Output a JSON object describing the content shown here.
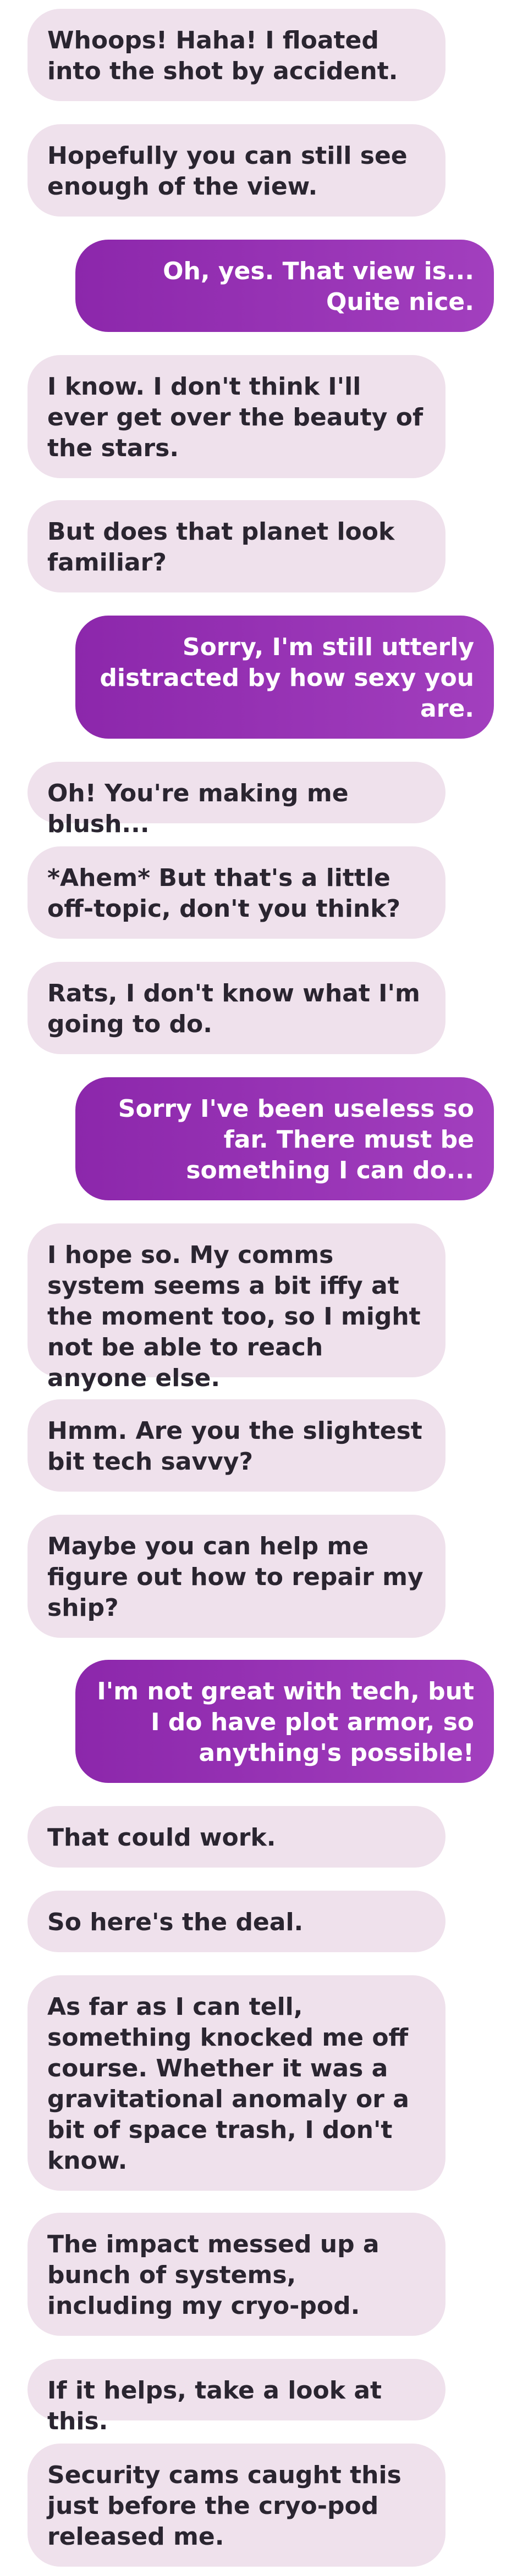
{
  "conversation": {
    "messages": [
      {
        "sender": "character",
        "text": "Whoops! Haha! I floated into the shot by accident."
      },
      {
        "sender": "character",
        "text": "Hopefully you can still see enough of the view."
      },
      {
        "sender": "user",
        "text": "Oh, yes. That view is... Quite nice."
      },
      {
        "sender": "character",
        "text": "I know. I don't think I'll ever get over the beauty of the stars."
      },
      {
        "sender": "character",
        "text": "But does that planet look familiar?"
      },
      {
        "sender": "user",
        "text": "Sorry, I'm still utterly distracted by how sexy you are."
      },
      {
        "sender": "character",
        "text": "Oh! You're making me blush..."
      },
      {
        "sender": "character",
        "text": "*Ahem* But that's a little off-topic, don't you think?"
      },
      {
        "sender": "character",
        "text": "Rats, I don't know what I'm going to do."
      },
      {
        "sender": "user",
        "text": "Sorry I've been useless so far. There must be something I can do..."
      },
      {
        "sender": "character",
        "text": "I hope so. My comms system seems a bit iffy at the moment too, so I might not be able to reach anyone else."
      },
      {
        "sender": "character",
        "text": "Hmm. Are you the slightest bit tech savvy?"
      },
      {
        "sender": "character",
        "text": "Maybe you can help me figure out how to repair my ship?"
      },
      {
        "sender": "user",
        "text": "I'm not great with tech, but I do have plot armor, so anything's possible!"
      },
      {
        "sender": "character",
        "text": "That could work."
      },
      {
        "sender": "character",
        "text": "So here's the deal."
      },
      {
        "sender": "character",
        "text": "As far as I can tell, something knocked me off course. Whether it was a gravitational anomaly or a bit of space trash, I don't know."
      },
      {
        "sender": "character",
        "text": "The impact messed up a bunch of systems, including my cryo-pod."
      },
      {
        "sender": "character",
        "text": "If it helps, take a look at this."
      },
      {
        "sender": "character",
        "text": "Security cams caught this just before the cryo-pod released me."
      }
    ]
  },
  "colors": {
    "incoming_bubble": "#efe1ec",
    "incoming_text": "#2a2530",
    "outgoing_bubble": "#9a33b6",
    "outgoing_text": "#ffffff",
    "background": "#ffffff"
  }
}
